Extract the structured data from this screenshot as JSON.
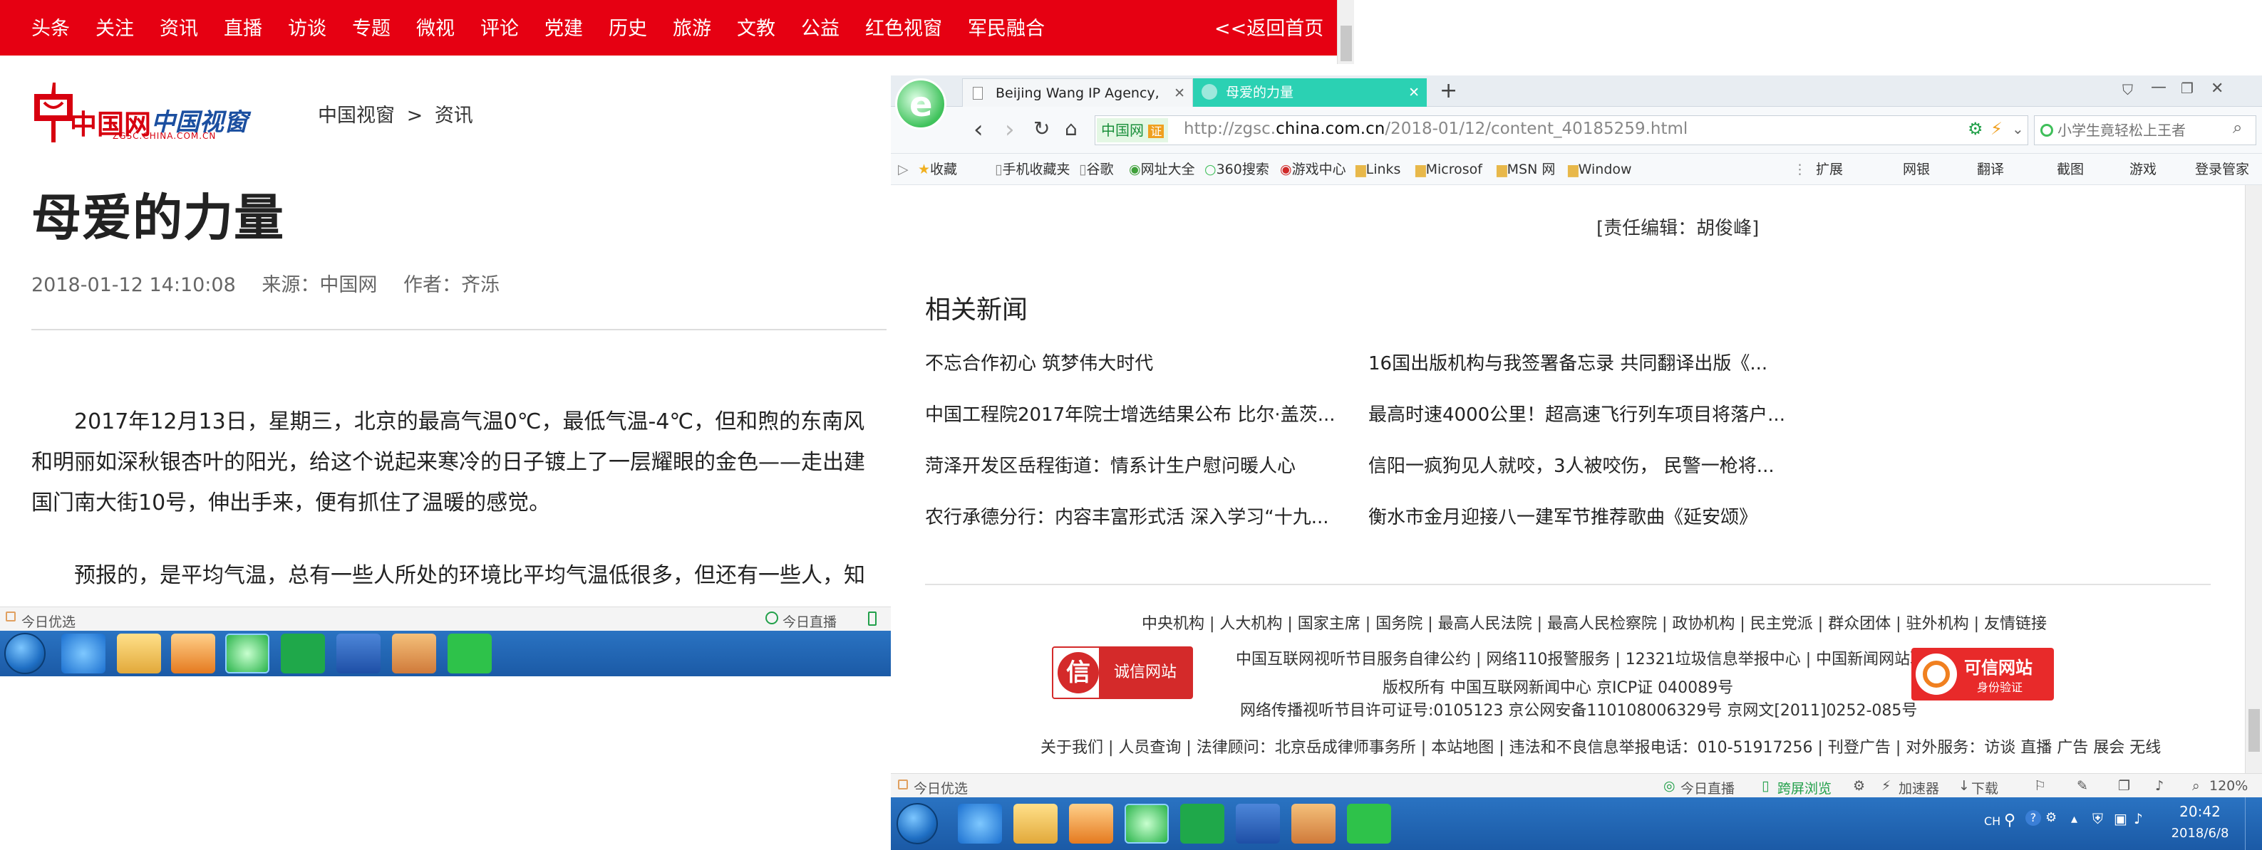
{
  "left": {
    "nav": [
      "头条",
      "关注",
      "资讯",
      "直播",
      "访谈",
      "专题",
      "微视",
      "评论",
      "党建",
      "历史",
      "旅游",
      "文教",
      "公益",
      "红色视窗",
      "军民融合"
    ],
    "nav_back": "<<返回首页",
    "logo_cn": "中国网",
    "logo_brand": "中国视窗",
    "logo_url": "ZGSC.CHINA.COM.CN",
    "breadcrumb": [
      "中国视窗",
      ">",
      "资讯"
    ],
    "title": "母爱的力量",
    "meta_date": "2018-01-12 14:10:08",
    "meta_source": "来源：中国网",
    "meta_author": "作者：齐泺",
    "paragraph1": "2017年12月13日，星期三，北京的最高气温0℃，最低气温-4℃，但和煦的东南风和明丽如深秋银杏叶的阳光，给这个说起来寒冷的日子镀上了一层耀眼的金色——走出建国门南大街10号，伸出手来，便有抓住了温暖的感觉。",
    "paragraph2": "预报的，是平均气温，总有一些人所处的环境比平均气温低很多，但还有一些人，知道高",
    "status_left": "今日优选",
    "status_right": "今日直播"
  },
  "right": {
    "tabs": [
      {
        "label": "Beijing Wang IP Agency, Ltd.,",
        "active": false
      },
      {
        "label": "母爱的力量",
        "active": true
      }
    ],
    "site_badge": "中国网",
    "site_badge_verify": "证",
    "url_prefix": "http://zgsc.",
    "url_domain": "china.com.cn",
    "url_path": "/2018-01/12/content_40185259.html",
    "search_placeholder": "小学生竟轻松上王者",
    "bookmarks": [
      "收藏",
      "手机收藏夹",
      "谷歌",
      "网址大全",
      "360搜索",
      "游戏中心",
      "Links",
      "Microsof",
      "MSN 网",
      "Window"
    ],
    "bookmarks_right": [
      "扩展",
      "网银",
      "翻译",
      "截图",
      "游戏",
      "登录管家"
    ],
    "editor": "[责任编辑：胡俊峰]",
    "related_heading": "相关新闻",
    "related": [
      [
        "不忘合作初心 筑梦伟大时代",
        "16国出版机构与我签署备忘录 共同翻译出版《..."
      ],
      [
        "中国工程院2017年院士增选结果公布 比尔·盖茨...",
        "最高时速4000公里！超高速飞行列车项目将落户..."
      ],
      [
        "菏泽开发区岳程街道：情系计生户慰问暖人心",
        "信阳一疯狗见人就咬，3人被咬伤， 民警一枪将..."
      ],
      [
        "农行承德分行：内容丰富形式活 深入学习“十九...",
        "衡水市金月迎接八一建军节推荐歌曲《延安颂》"
      ]
    ],
    "footer_links": "中央机构 | 人大机构 | 国家主席 | 国务院 | 最高人民法院 | 最高人民检察院 | 政协机构 | 民主党派 | 群众团体 | 驻外机构 | 友情链接",
    "footer_line1": "中国互联网视听节目服务自律公约 | 网络110报警服务 | 12321垃圾信息举报中心 | 中国新闻网站联盟",
    "footer_line2": "版权所有 中国互联网新闻中心 京ICP证 040089号",
    "footer_line3": "网络传播视听节目许可证号:0105123 京公网安备110108006329号 京网文[2011]0252-085号",
    "footer_line4": "关于我们 | 人员查询 | 法律顾问：北京岳成律师事务所 | 本站地图 | 违法和不良信息举报电话：010-51917256 | 刊登广告 | 对外服务：访谈 直播 广告 展会 无线",
    "badge_left_icon": "信",
    "badge_left_text": "诚信网站",
    "badge_right_title": "可信网站",
    "badge_right_sub": "身份验证",
    "status": {
      "left": "今日优选",
      "items": [
        "今日直播",
        "跨屏浏览",
        "加速器",
        "下载"
      ],
      "zoom": "120%"
    },
    "tray": {
      "lang": "CH",
      "time": "20:42",
      "date": "2018/6/8"
    }
  },
  "colors": {
    "nav_red": "#e60012",
    "tab_active": "#2bd1b3",
    "taskbar_blue": "#1f65b4",
    "link_blue": "#1b5cb8"
  }
}
